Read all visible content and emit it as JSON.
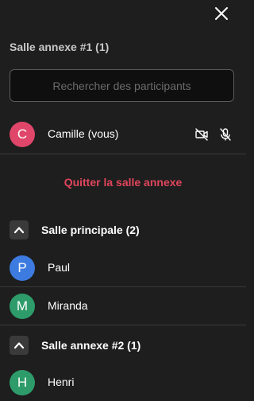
{
  "panel": {
    "close_icon": "close-icon",
    "room_title": "Salle annexe #1 (1)",
    "search": {
      "placeholder": "Rechercher des participants",
      "value": ""
    },
    "current_user": {
      "initial": "C",
      "name": "Camille (vous)",
      "avatar_color": "#e0466a",
      "camera_icon": "camera-off-icon",
      "mic_icon": "mic-off-icon"
    },
    "leave_label": "Quitter la salle annexe",
    "leave_color": "#e0465c",
    "groups": [
      {
        "label": "Salle principale (2)",
        "chevron_icon": "chevron-up-icon",
        "participants": [
          {
            "initial": "P",
            "name": "Paul",
            "avatar_color": "#3d7be0"
          },
          {
            "initial": "M",
            "name": "Miranda",
            "avatar_color": "#2e9c6a"
          }
        ]
      },
      {
        "label": "Salle annexe #2 (1)",
        "chevron_icon": "chevron-up-icon",
        "participants": [
          {
            "initial": "H",
            "name": "Henri",
            "avatar_color": "#2e9c6a"
          }
        ]
      }
    ]
  }
}
